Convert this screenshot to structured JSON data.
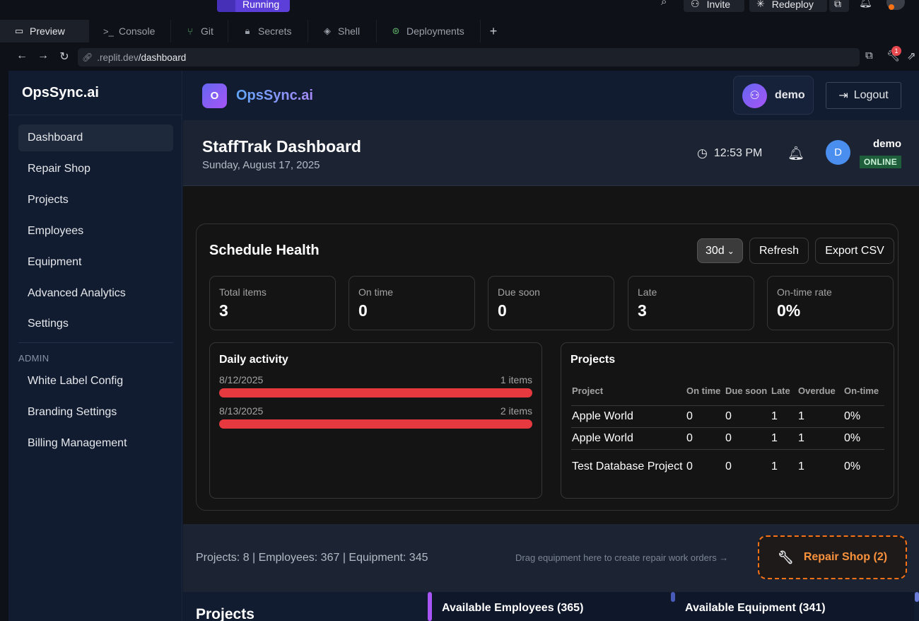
{
  "replit": {
    "status_badge": "Running",
    "invite_label": "Invite",
    "redeploy_label": "Redeploy",
    "tabs": [
      {
        "label": "Preview",
        "icon": "monitor-icon",
        "glyph": "▭"
      },
      {
        "label": "Console",
        "icon": "terminal-icon",
        "glyph": ">_"
      },
      {
        "label": "Git",
        "icon": "git-icon",
        "glyph": "⑂"
      },
      {
        "label": "Secrets",
        "icon": "lock-icon",
        "glyph": "🔒︎"
      },
      {
        "label": "Shell",
        "icon": "shell-icon",
        "glyph": "◈"
      },
      {
        "label": "Deployments",
        "icon": "deploy-icon",
        "glyph": "⊛"
      }
    ],
    "url_host": ".replit.dev",
    "url_path": "/dashboard",
    "devtools_badge": "1"
  },
  "sidebar": {
    "brand": "OpsSync.ai",
    "items": [
      {
        "label": "Dashboard",
        "active": true
      },
      {
        "label": "Repair Shop"
      },
      {
        "label": "Projects"
      },
      {
        "label": "Employees"
      },
      {
        "label": "Equipment"
      },
      {
        "label": "Advanced Analytics"
      },
      {
        "label": "Settings"
      }
    ],
    "admin_heading": "ADMIN",
    "admin_items": [
      {
        "label": "White Label Config"
      },
      {
        "label": "Branding Settings"
      },
      {
        "label": "Billing Management"
      }
    ]
  },
  "topnav": {
    "logo_letter": "O",
    "brand": "OpsSync.ai",
    "user": "demo",
    "logout_label": "Logout"
  },
  "header": {
    "title": "StaffTrak Dashboard",
    "date": "Sunday, August 17, 2025",
    "time": "12:53 PM",
    "avatar_letter": "D",
    "user": "demo",
    "status": "ONLINE"
  },
  "schedule_health": {
    "title": "Schedule Health",
    "range_selected": "30d",
    "refresh_label": "Refresh",
    "export_label": "Export CSV",
    "stats": [
      {
        "label": "Total items",
        "value": "3"
      },
      {
        "label": "On time",
        "value": "0"
      },
      {
        "label": "Due soon",
        "value": "0"
      },
      {
        "label": "Late",
        "value": "3"
      },
      {
        "label": "On-time rate",
        "value": "0%"
      }
    ],
    "daily_activity": {
      "title": "Daily activity",
      "rows": [
        {
          "date": "8/12/2025",
          "count": "1 items",
          "fill": 1.0
        },
        {
          "date": "8/13/2025",
          "count": "2 items",
          "fill": 1.0
        }
      ]
    },
    "projects": {
      "title": "Projects",
      "columns": [
        "Project",
        "On time",
        "Due soon",
        "Late",
        "Overdue",
        "On-time"
      ],
      "rows": [
        [
          "Apple World",
          "0",
          "0",
          "1",
          "1",
          "0%"
        ],
        [
          "Apple World",
          "0",
          "0",
          "1",
          "1",
          "0%"
        ],
        [
          "Test Database Project",
          "0",
          "0",
          "1",
          "1",
          "0%"
        ]
      ]
    }
  },
  "footer": {
    "counts": "Projects: 8 | Employees: 367 | Equipment: 345",
    "drag_hint": "Drag equipment here to create repair work orders →",
    "repair_label": "Repair Shop (2)"
  },
  "bottom": {
    "projects_heading": "Projects",
    "available_employees": "Available Employees (365)",
    "available_equipment": "Available Equipment (341)"
  },
  "colors": {
    "accent_purple": "#a855f7",
    "late_bar": "#e5393f",
    "repair_orange": "#f97316",
    "online_green": "#1f5e3b"
  }
}
